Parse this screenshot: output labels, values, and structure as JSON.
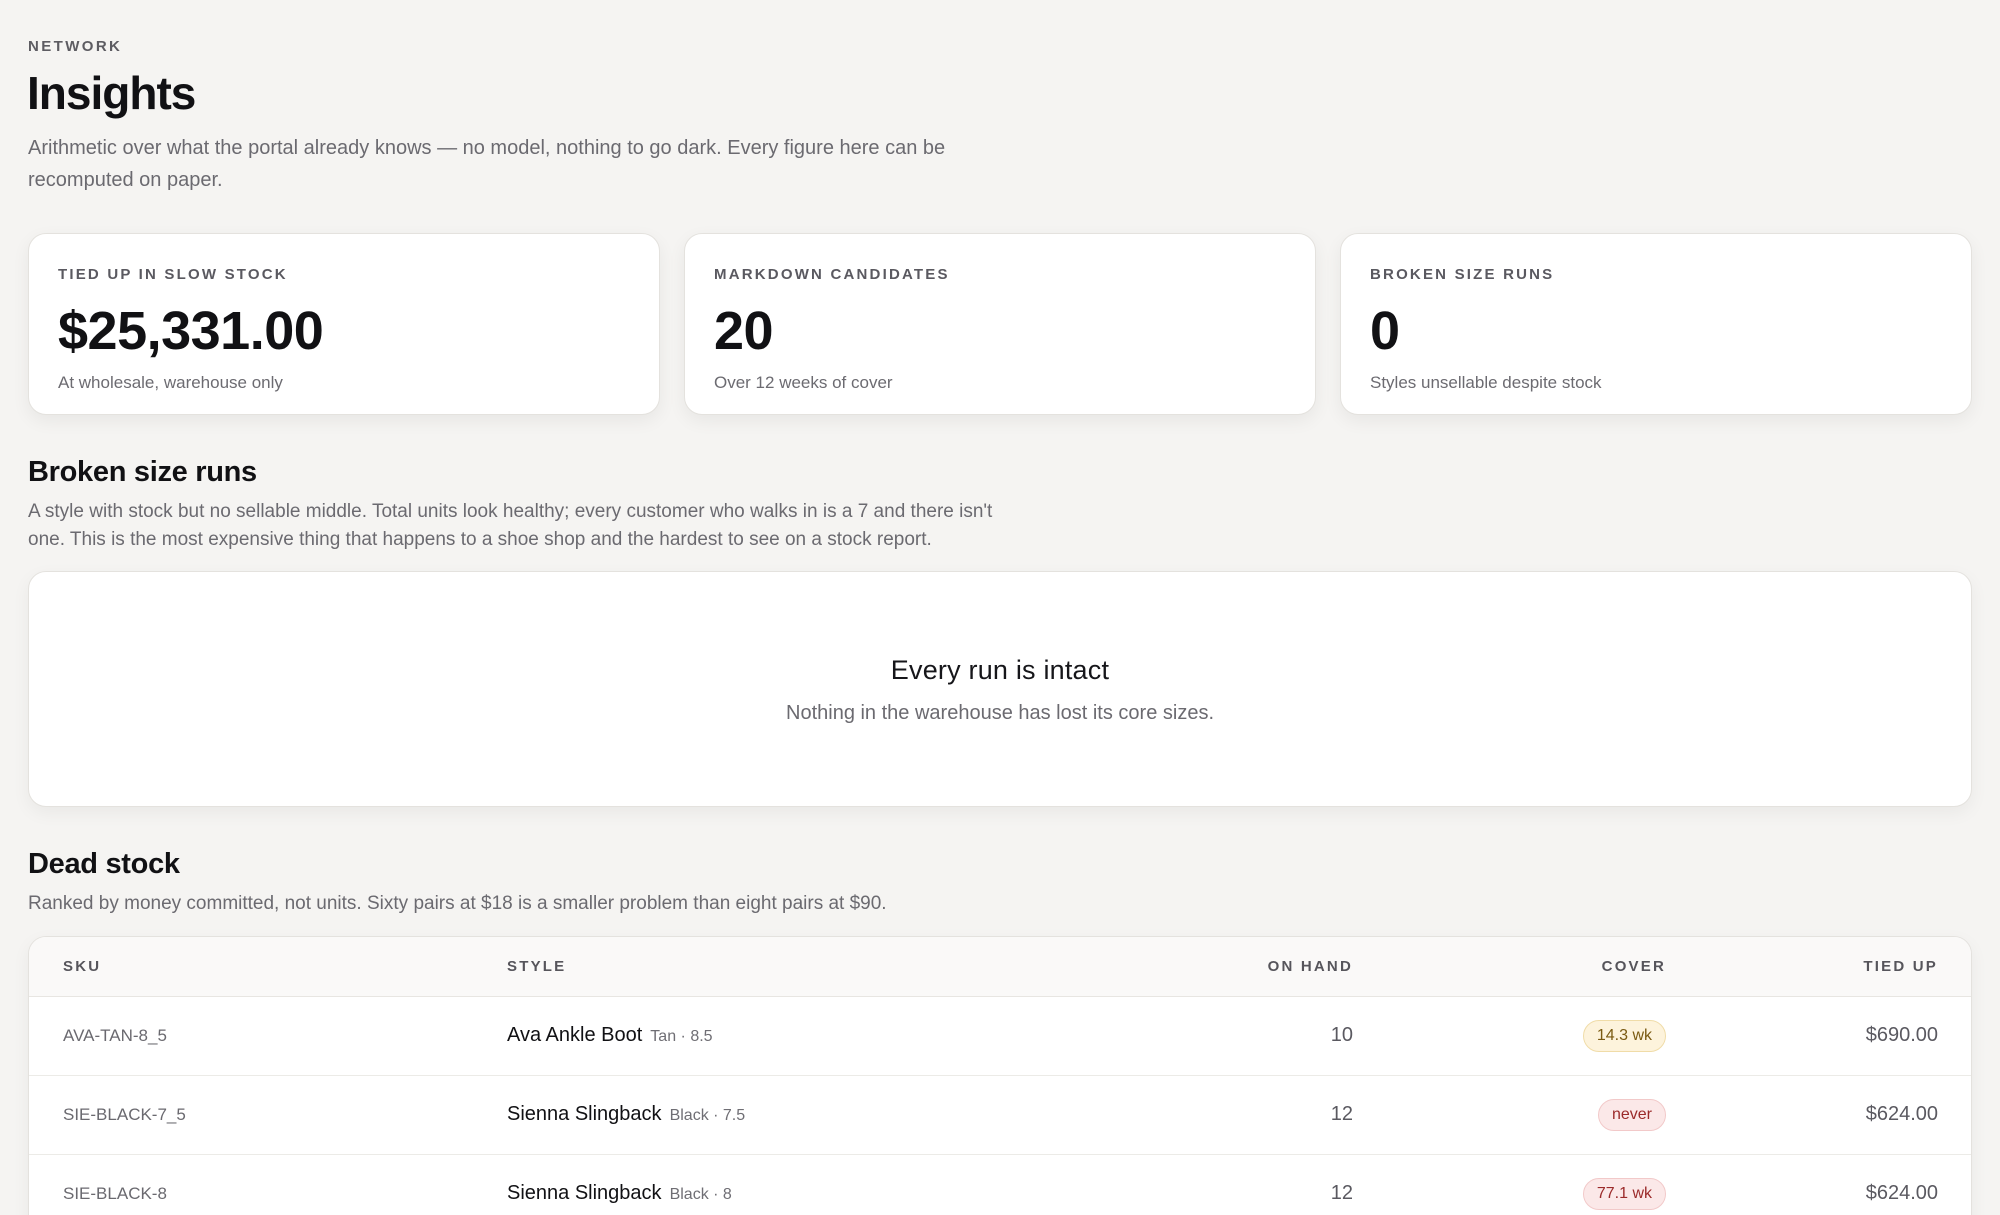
{
  "header": {
    "eyebrow": "NETWORK",
    "title": "Insights",
    "lede": "Arithmetic over what the portal already knows — no model, nothing to go dark. Every figure here can be recomputed on paper."
  },
  "stats": [
    {
      "label": "TIED UP IN SLOW STOCK",
      "value": "$25,331.00",
      "sub": "At wholesale, warehouse only"
    },
    {
      "label": "MARKDOWN CANDIDATES",
      "value": "20",
      "sub": "Over 12 weeks of cover"
    },
    {
      "label": "BROKEN SIZE RUNS",
      "value": "0",
      "sub": "Styles unsellable despite stock"
    }
  ],
  "broken_runs": {
    "title": "Broken size runs",
    "desc": "A style with stock but no sellable middle. Total units look healthy; every customer who walks in is a 7 and there isn't one. This is the most expensive thing that happens to a shoe shop and the hardest to see on a stock report.",
    "empty_title": "Every run is intact",
    "empty_sub": "Nothing in the warehouse has lost its core sizes."
  },
  "dead_stock": {
    "title": "Dead stock",
    "desc": "Ranked by money committed, not units. Sixty pairs at $18 is a smaller problem than eight pairs at $90.",
    "columns": {
      "sku": "SKU",
      "style": "STYLE",
      "on_hand": "ON HAND",
      "cover": "COVER",
      "tied_up": "TIED UP"
    },
    "rows": [
      {
        "sku": "AVA-TAN-8_5",
        "style": "Ava Ankle Boot",
        "variant": "Tan · 8.5",
        "on_hand": "10",
        "cover": "14.3 wk",
        "cover_level": "warn",
        "tied_up": "$690.00"
      },
      {
        "sku": "SIE-BLACK-7_5",
        "style": "Sienna Slingback",
        "variant": "Black · 7.5",
        "on_hand": "12",
        "cover": "never",
        "cover_level": "bad",
        "tied_up": "$624.00"
      },
      {
        "sku": "SIE-BLACK-8",
        "style": "Sienna Slingback",
        "variant": "Black · 8",
        "on_hand": "12",
        "cover": "77.1 wk",
        "cover_level": "bad",
        "tied_up": "$624.00"
      }
    ]
  }
}
